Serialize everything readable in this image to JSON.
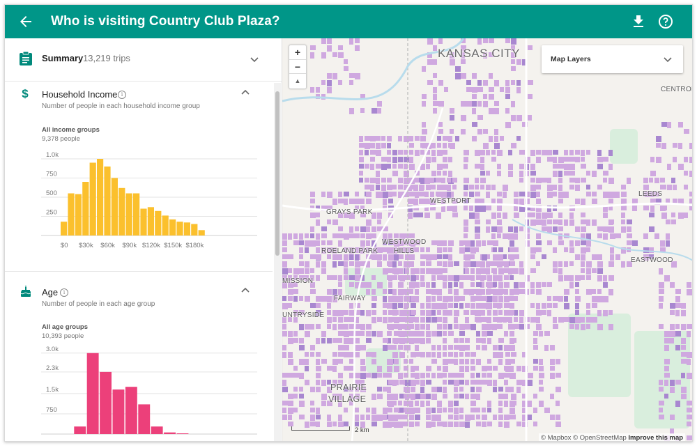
{
  "app": {
    "title": "Who is visiting Country Club Plaza?"
  },
  "summary": {
    "label": "Summary",
    "count": "13,219 trips"
  },
  "household_income": {
    "title": "Household Income",
    "subtitle": "Number of people in each household income group",
    "group_title": "All income groups",
    "group_count": "9,378 people",
    "color": "#FBC02D"
  },
  "age": {
    "title": "Age",
    "subtitle": "Number of people in each age group",
    "group_title": "All age groups",
    "group_count": "10,393 people",
    "color": "#EC407A"
  },
  "chart_data": [
    {
      "type": "bar",
      "title": "Household Income",
      "x": [
        0,
        10,
        20,
        30,
        40,
        50,
        60,
        70,
        80,
        90,
        100,
        110,
        120,
        130,
        140,
        150,
        160,
        170,
        180,
        190
      ],
      "values": [
        180,
        550,
        540,
        700,
        950,
        1000,
        900,
        750,
        620,
        550,
        550,
        350,
        370,
        320,
        260,
        210,
        180,
        170,
        150,
        70
      ],
      "x_tick_labels": [
        "$0",
        "$30k",
        "$60k",
        "$90k",
        "$120k",
        "$150k",
        "$180k"
      ],
      "y_tick_labels": [
        "250",
        "500",
        "750",
        "1.0k"
      ],
      "ylim": [
        0,
        1100
      ],
      "grid": true
    },
    {
      "type": "bar",
      "title": "Age",
      "x": [
        10,
        15,
        20,
        25,
        30,
        35,
        40,
        45,
        50,
        55,
        60,
        65,
        70,
        75,
        80
      ],
      "values": [
        0,
        0,
        280,
        3000,
        2300,
        1650,
        1750,
        1100,
        280,
        60,
        10,
        0,
        0,
        0,
        0
      ],
      "y_tick_labels": [
        "750",
        "1.5k",
        "2.3k",
        "3.0k"
      ],
      "ylim": [
        0,
        3200
      ],
      "grid": true
    }
  ],
  "map": {
    "layers_label": "Map Layers",
    "zoom_in": "+",
    "zoom_out": "−",
    "compass": "▲",
    "scale": "2 km",
    "attribution": "© Mapbox © OpenStreetMap",
    "improve": "Improve this map",
    "labels": {
      "kansas_city": "KANSAS CITY",
      "centropolis": "CENTROPO",
      "grays_park": "GRAYS PARK",
      "westport": "WESTPORT",
      "roeland_park": "ROELAND PARK",
      "westwood": "WESTWOOD",
      "hills": "HILLS",
      "leeds": "LEEDS",
      "eastwood": "EASTWOOD",
      "mission": "MISSION",
      "fairway": "FAIRWAY",
      "countryside": "UNTRYSIDE",
      "prairie": "PRAIRIE",
      "village": "VILLAGE"
    },
    "colors": {
      "block": "#cfa8e0",
      "block_dark": "#a887d0",
      "water": "#c6e3f0",
      "park": "#d9eedd"
    }
  }
}
